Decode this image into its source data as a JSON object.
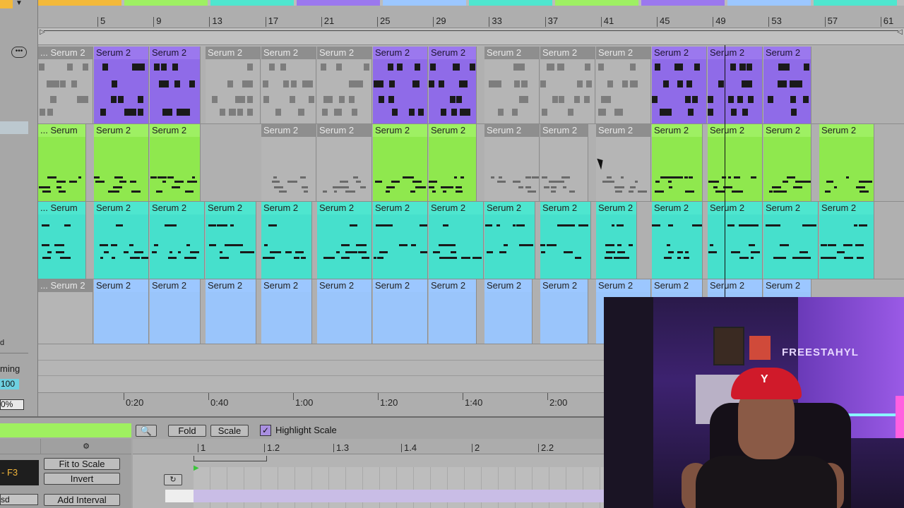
{
  "sidebar": {
    "track_label": "d",
    "groove_label": "ming",
    "value": "100",
    "percent": "0%"
  },
  "ruler": {
    "bars": [
      "5",
      "9",
      "13",
      "17",
      "21",
      "25",
      "29",
      "33",
      "37",
      "41",
      "45",
      "49",
      "53",
      "57",
      "61"
    ]
  },
  "time_ruler": {
    "times": [
      "0:20",
      "0:40",
      "1:00",
      "1:20",
      "1:40",
      "2:00"
    ]
  },
  "clip_name": "Serum 2",
  "clip_name_truncated": "... Serum 2",
  "clip_name_short": "Serum",
  "editor": {
    "search_icon": "magnifier-icon",
    "fold_label": "Fold",
    "scale_label": "Scale",
    "highlight_scale_label": "Highlight Scale",
    "highlight_scale_checked": true,
    "key_value": "- F3",
    "fit_to_scale_label": "Fit to Scale",
    "invert_label": "Invert",
    "add_interval_label": "Add Interval",
    "sd_value": "sd",
    "ruler": [
      "1",
      "1.2",
      "1.3",
      "1.4",
      "2",
      "2.2"
    ]
  },
  "webcam": {
    "neon_sign": "FREESTAHYL"
  },
  "colors": {
    "purple": "#8f6be8",
    "green": "#8fe84e",
    "cyan": "#46e0cc",
    "blue": "#9ac5fb",
    "grey": "#b5b5b5"
  }
}
